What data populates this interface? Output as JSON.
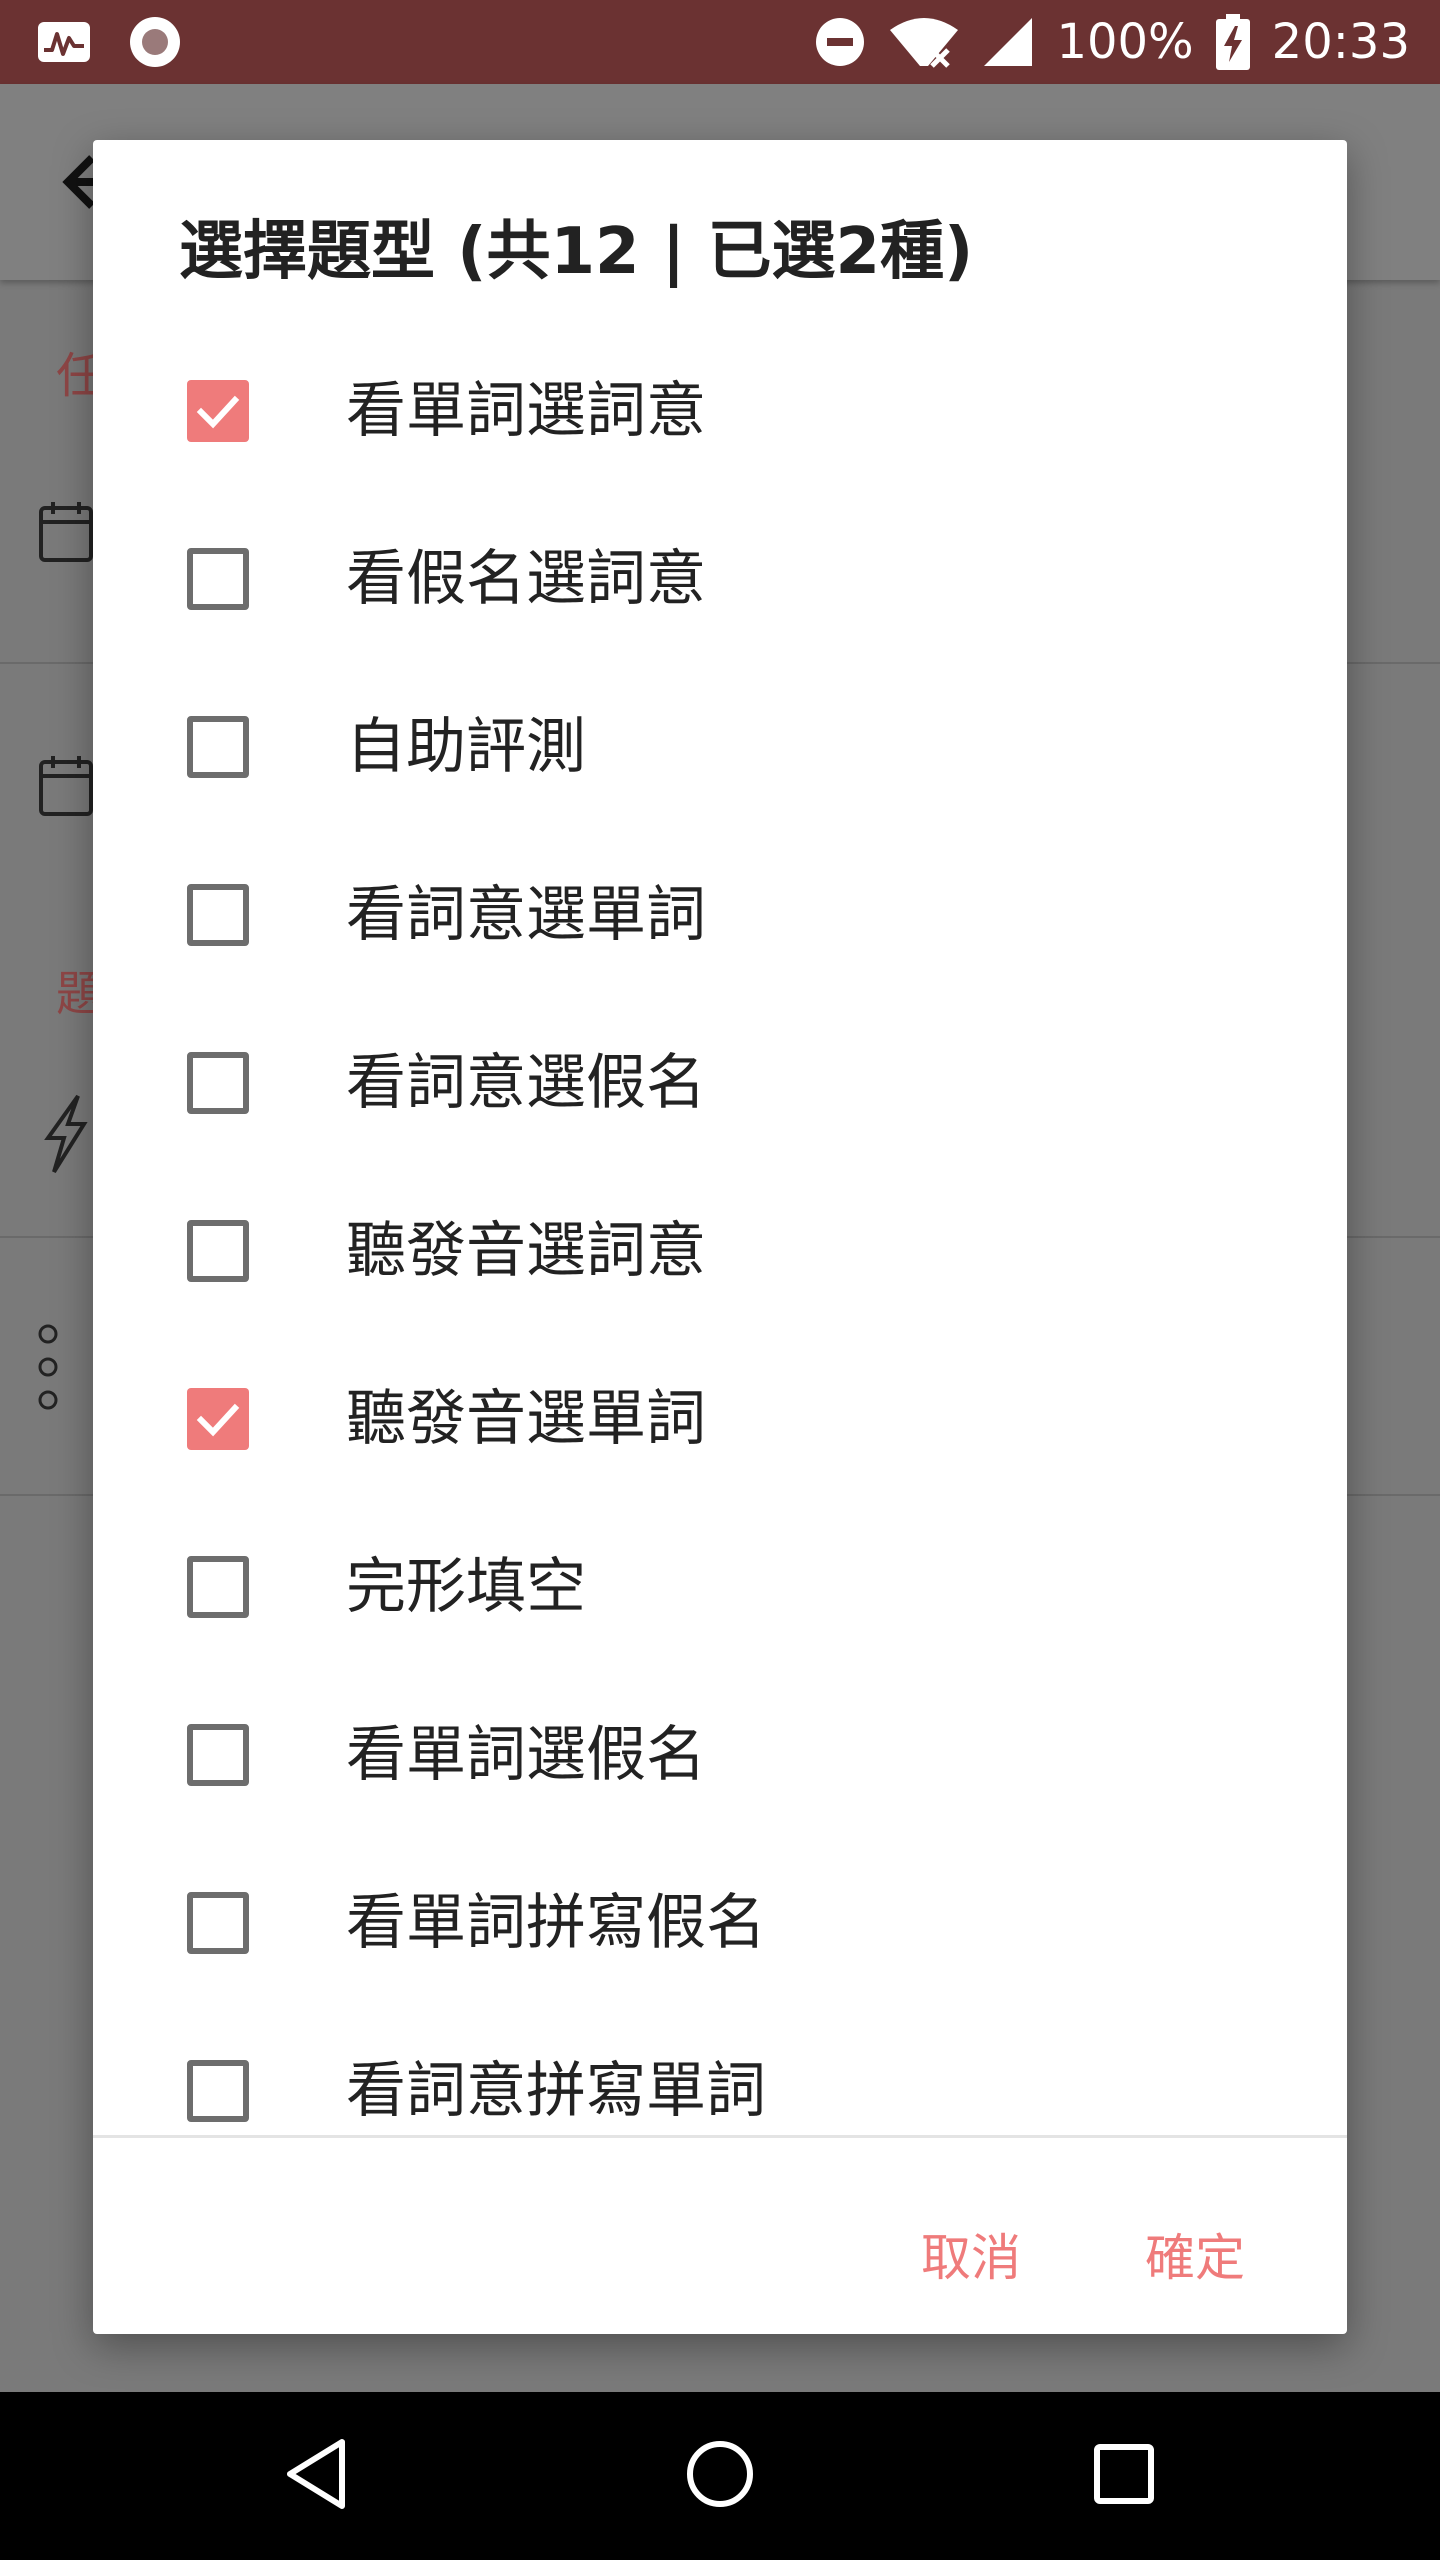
{
  "status_bar": {
    "battery_percent": "100%",
    "time": "20:33",
    "icons": [
      "activity-monitor-icon",
      "record-icon",
      "do-not-disturb-icon",
      "wifi-no-internet-icon",
      "cell-signal-icon",
      "battery-charging-icon"
    ]
  },
  "dialog": {
    "title": "選擇題型 (共12 | 已選2種)",
    "options": [
      {
        "label": "看單詞選詞意",
        "checked": true
      },
      {
        "label": "看假名選詞意",
        "checked": false
      },
      {
        "label": "自助評測",
        "checked": false
      },
      {
        "label": "看詞意選單詞",
        "checked": false
      },
      {
        "label": "看詞意選假名",
        "checked": false
      },
      {
        "label": "聽發音選詞意",
        "checked": false
      },
      {
        "label": "聽發音選單詞",
        "checked": true
      },
      {
        "label": "完形填空",
        "checked": false
      },
      {
        "label": "看單詞選假名",
        "checked": false
      },
      {
        "label": "看單詞拼寫假名",
        "checked": false
      },
      {
        "label": "看詞意拼寫單詞",
        "checked": false
      }
    ],
    "cancel_label": "取消",
    "ok_label": "確定"
  },
  "background": {
    "section1_label": "任",
    "section2_label": "題"
  },
  "colors": {
    "status_bar": "#6b3232",
    "accent": "#ef7b7b",
    "text": "#222222",
    "nav_bar": "#000000"
  }
}
